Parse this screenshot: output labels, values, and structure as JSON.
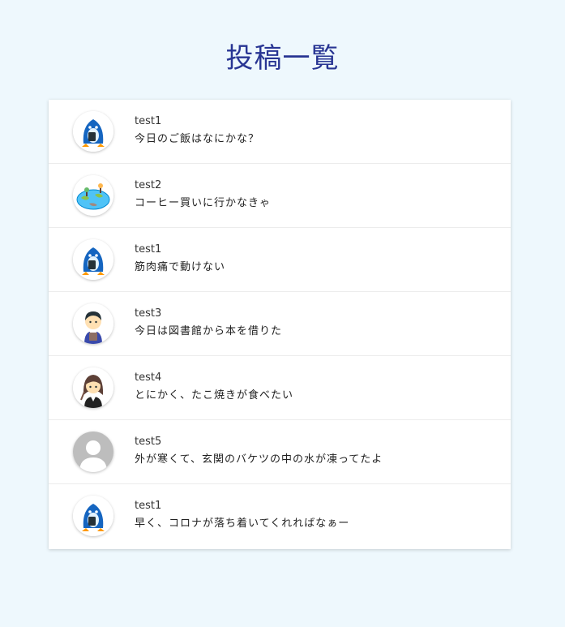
{
  "page": {
    "title": "投稿一覧"
  },
  "posts": [
    {
      "user": "test1",
      "body": "今日のご飯はなにかな？",
      "avatar": "penguin-avatar-icon"
    },
    {
      "user": "test2",
      "body": "コーヒー買いに行かなきゃ",
      "avatar": "earth-avatar-icon"
    },
    {
      "user": "test1",
      "body": "筋肉痛で動けない",
      "avatar": "penguin-avatar-icon"
    },
    {
      "user": "test3",
      "body": "今日は図書館から本を借りた",
      "avatar": "boy-avatar-icon"
    },
    {
      "user": "test4",
      "body": "とにかく、たこ焼きが食べたい",
      "avatar": "girl-avatar-icon"
    },
    {
      "user": "test5",
      "body": "外が寒くて、玄関のバケツの中の水が凍ってたよ",
      "avatar": "default-user-avatar-icon"
    },
    {
      "user": "test1",
      "body": "早く、コロナが落ち着いてくれればなぁー",
      "avatar": "penguin-avatar-icon"
    }
  ]
}
